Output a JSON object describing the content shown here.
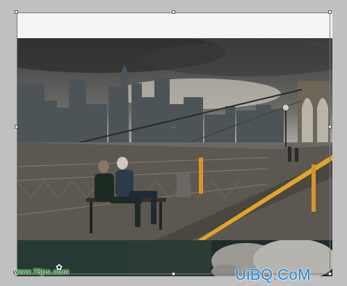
{
  "canvas": {
    "photo_description_name": "brooklyn-bridge-hdr-photo",
    "selection_visible": true
  },
  "watermarks": {
    "left_text": "www.78ps.com",
    "left_icon": "✿",
    "right_text": "UiBQ.CoM"
  },
  "colors": {
    "workspace": "#c0c0c0",
    "watermark_left": "#1e8a1e",
    "watermark_right": "#1a86d6",
    "bridge_stripe": "#e0a52a"
  }
}
